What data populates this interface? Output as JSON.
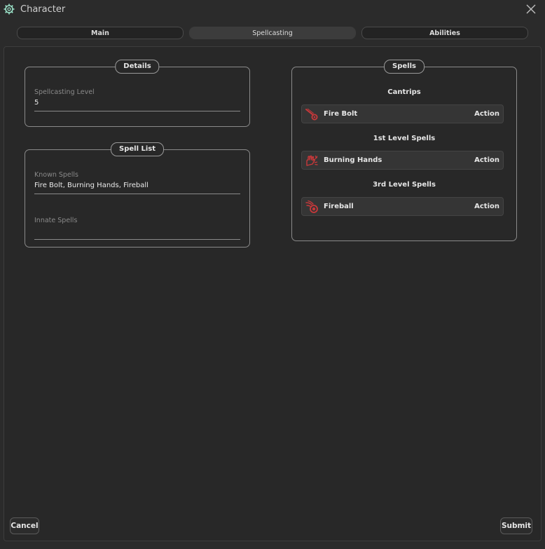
{
  "window": {
    "title": "Character"
  },
  "tabs": [
    {
      "label": "Main"
    },
    {
      "label": "Spellcasting"
    },
    {
      "label": "Abilities"
    }
  ],
  "details": {
    "title": "Details",
    "spellcasting_level_label": "Spellcasting Level",
    "spellcasting_level_value": "5"
  },
  "spell_list": {
    "title": "Spell List",
    "known_label": "Known Spells",
    "known_value": "Fire Bolt, Burning Hands, Fireball",
    "innate_label": "Innate Spells",
    "innate_value": ""
  },
  "spells": {
    "title": "Spells",
    "sections": [
      {
        "heading": "Cantrips",
        "spells": [
          {
            "name": "Fire Bolt",
            "casting": "Action",
            "icon": "fire-bolt-icon"
          }
        ]
      },
      {
        "heading": "1st Level Spells",
        "spells": [
          {
            "name": "Burning Hands",
            "casting": "Action",
            "icon": "burning-hands-icon"
          }
        ]
      },
      {
        "heading": "3rd Level Spells",
        "spells": [
          {
            "name": "Fireball",
            "casting": "Action",
            "icon": "fireball-icon"
          }
        ]
      }
    ]
  },
  "buttons": {
    "cancel": "Cancel",
    "submit": "Submit"
  },
  "colors": {
    "background": "#2b2b2b",
    "spell_icon": "#c8383a",
    "app_icon": "#9be2c8"
  }
}
